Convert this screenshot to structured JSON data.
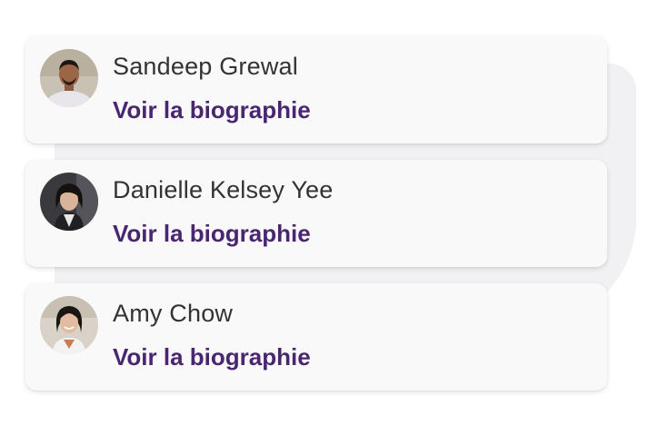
{
  "colors": {
    "name_text": "#333333",
    "link_text": "#4a2670",
    "card_bg": "#f9f9fa",
    "backdrop": "#f1f1f4"
  },
  "people": [
    {
      "name": "Sandeep Grewal",
      "link_label": "Voir la biographie",
      "avatar": "avatar-photo"
    },
    {
      "name": "Danielle Kelsey Yee",
      "link_label": "Voir la biographie",
      "avatar": "avatar-photo"
    },
    {
      "name": "Amy Chow",
      "link_label": "Voir la biographie",
      "avatar": "avatar-photo"
    }
  ]
}
